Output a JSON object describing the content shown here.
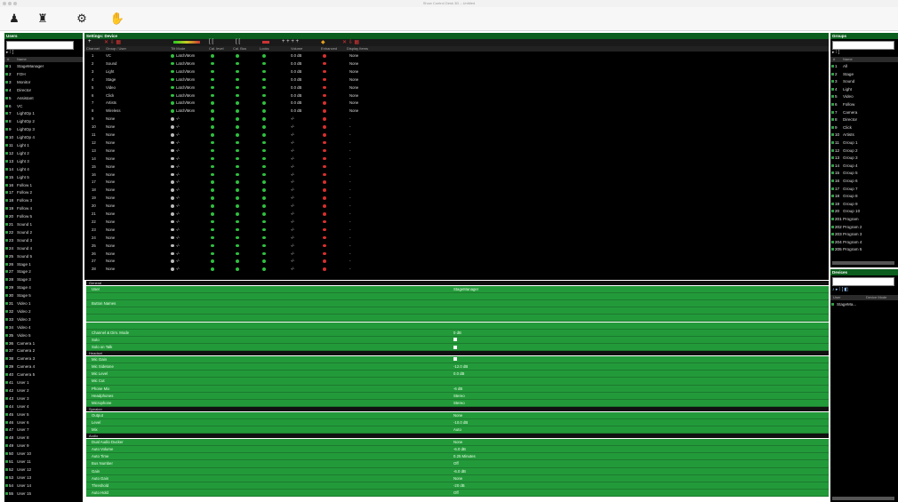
{
  "window": {
    "title": "Show Control Desk 3D – Untitled"
  },
  "toolbar": {
    "buttons": [
      {
        "icon": "person-icon",
        "glyph": "♟"
      },
      {
        "icon": "mixer-icon",
        "glyph": "♜"
      },
      {
        "icon": "gears-icon",
        "glyph": "⚙"
      },
      {
        "icon": "hands-icon",
        "glyph": "✋"
      }
    ]
  },
  "users": {
    "title": "Users",
    "col_number": "#",
    "col_name": "Name",
    "items": [
      {
        "n": "1",
        "name": "StageManager"
      },
      {
        "n": "2",
        "name": "FOH"
      },
      {
        "n": "3",
        "name": "Monitor"
      },
      {
        "n": "4",
        "name": "Director"
      },
      {
        "n": "5",
        "name": "Assistant"
      },
      {
        "n": "6",
        "name": "VC"
      },
      {
        "n": "7",
        "name": "LightOp 1"
      },
      {
        "n": "8",
        "name": "LightOp 2"
      },
      {
        "n": "9",
        "name": "LightOp 3"
      },
      {
        "n": "10",
        "name": "LightOp 4"
      },
      {
        "n": "11",
        "name": "Light 1"
      },
      {
        "n": "12",
        "name": "Light 2"
      },
      {
        "n": "13",
        "name": "Light 3"
      },
      {
        "n": "14",
        "name": "Light 4"
      },
      {
        "n": "15",
        "name": "Light 5"
      },
      {
        "n": "16",
        "name": "Follow 1"
      },
      {
        "n": "17",
        "name": "Follow 2"
      },
      {
        "n": "18",
        "name": "Follow 3"
      },
      {
        "n": "19",
        "name": "Follow 4"
      },
      {
        "n": "20",
        "name": "Follow 5"
      },
      {
        "n": "21",
        "name": "Sound 1"
      },
      {
        "n": "22",
        "name": "Sound 2"
      },
      {
        "n": "23",
        "name": "Sound 3"
      },
      {
        "n": "24",
        "name": "Sound 4"
      },
      {
        "n": "25",
        "name": "Sound 5"
      },
      {
        "n": "26",
        "name": "Stage 1"
      },
      {
        "n": "27",
        "name": "Stage 2"
      },
      {
        "n": "28",
        "name": "Stage 3"
      },
      {
        "n": "29",
        "name": "Stage 4"
      },
      {
        "n": "30",
        "name": "Stage 5"
      },
      {
        "n": "31",
        "name": "Video 1"
      },
      {
        "n": "32",
        "name": "Video 2"
      },
      {
        "n": "33",
        "name": "Video 3"
      },
      {
        "n": "34",
        "name": "Video 4"
      },
      {
        "n": "35",
        "name": "Video 5"
      },
      {
        "n": "36",
        "name": "Camera 1"
      },
      {
        "n": "37",
        "name": "Camera 2"
      },
      {
        "n": "38",
        "name": "Camera 3"
      },
      {
        "n": "39",
        "name": "Camera 4"
      },
      {
        "n": "40",
        "name": "Camera 5"
      },
      {
        "n": "41",
        "name": "User 1"
      },
      {
        "n": "42",
        "name": "User 2"
      },
      {
        "n": "43",
        "name": "User 3"
      },
      {
        "n": "44",
        "name": "User 4"
      },
      {
        "n": "45",
        "name": "User 5"
      },
      {
        "n": "46",
        "name": "User 6"
      },
      {
        "n": "47",
        "name": "User 7"
      },
      {
        "n": "48",
        "name": "User 8"
      },
      {
        "n": "49",
        "name": "User 9"
      },
      {
        "n": "50",
        "name": "User 10"
      },
      {
        "n": "51",
        "name": "User 11"
      },
      {
        "n": "52",
        "name": "User 12"
      },
      {
        "n": "53",
        "name": "User 13"
      },
      {
        "n": "54",
        "name": "User 14"
      },
      {
        "n": "55",
        "name": "User 15"
      }
    ]
  },
  "patch": {
    "title": "Settings: Device",
    "columns": [
      "Channel",
      "Group / User",
      "Tilt Mode",
      "Cal. level",
      "Cal. Bus",
      "Locks",
      "Volume",
      "Enhanced",
      "Display Items"
    ],
    "rows": [
      {
        "ch": "1",
        "name": "VC",
        "mode": "Latch/Mom",
        "vol": "0.0 dB",
        "disp": "None",
        "active": true
      },
      {
        "ch": "2",
        "name": "Sound",
        "mode": "Latch/Mom",
        "vol": "0.0 dB",
        "disp": "None",
        "active": true
      },
      {
        "ch": "3",
        "name": "Light",
        "mode": "Latch/Mom",
        "vol": "0.0 dB",
        "disp": "None",
        "active": true
      },
      {
        "ch": "4",
        "name": "Stage",
        "mode": "Latch/Mom",
        "vol": "0.0 dB",
        "disp": "None",
        "active": true
      },
      {
        "ch": "5",
        "name": "Video",
        "mode": "Latch/Mom",
        "vol": "0.0 dB",
        "disp": "None",
        "active": true
      },
      {
        "ch": "6",
        "name": "Click",
        "mode": "Latch/Mom",
        "vol": "0.0 dB",
        "disp": "None",
        "active": true
      },
      {
        "ch": "7",
        "name": "Artists",
        "mode": "Latch/Mom",
        "vol": "0.0 dB",
        "disp": "None",
        "active": true
      },
      {
        "ch": "8",
        "name": "Wireless",
        "mode": "Latch/Mom",
        "vol": "0.0 dB",
        "disp": "None",
        "active": true
      },
      {
        "ch": "9",
        "name": "None",
        "mode": "-/-",
        "vol": "-/-",
        "disp": "-",
        "active": false
      },
      {
        "ch": "10",
        "name": "None",
        "mode": "-/-",
        "vol": "-/-",
        "disp": "-",
        "active": false
      },
      {
        "ch": "11",
        "name": "None",
        "mode": "-/-",
        "vol": "-/-",
        "disp": "-",
        "active": false
      },
      {
        "ch": "12",
        "name": "None",
        "mode": "-/-",
        "vol": "-/-",
        "disp": "-",
        "active": false
      },
      {
        "ch": "13",
        "name": "None",
        "mode": "-/-",
        "vol": "-/-",
        "disp": "-",
        "active": false
      },
      {
        "ch": "14",
        "name": "None",
        "mode": "-/-",
        "vol": "-/-",
        "disp": "-",
        "active": false
      },
      {
        "ch": "15",
        "name": "None",
        "mode": "-/-",
        "vol": "-/-",
        "disp": "-",
        "active": false
      },
      {
        "ch": "16",
        "name": "None",
        "mode": "-/-",
        "vol": "-/-",
        "disp": "-",
        "active": false
      },
      {
        "ch": "17",
        "name": "None",
        "mode": "-/-",
        "vol": "-/-",
        "disp": "-",
        "active": false
      },
      {
        "ch": "18",
        "name": "None",
        "mode": "-/-",
        "vol": "-/-",
        "disp": "-",
        "active": false
      },
      {
        "ch": "19",
        "name": "None",
        "mode": "-/-",
        "vol": "-/-",
        "disp": "-",
        "active": false
      },
      {
        "ch": "20",
        "name": "None",
        "mode": "-/-",
        "vol": "-/-",
        "disp": "-",
        "active": false
      },
      {
        "ch": "21",
        "name": "None",
        "mode": "-/-",
        "vol": "-/-",
        "disp": "-",
        "active": false
      },
      {
        "ch": "22",
        "name": "None",
        "mode": "-/-",
        "vol": "-/-",
        "disp": "-",
        "active": false
      },
      {
        "ch": "23",
        "name": "None",
        "mode": "-/-",
        "vol": "-/-",
        "disp": "-",
        "active": false
      },
      {
        "ch": "24",
        "name": "None",
        "mode": "-/-",
        "vol": "-/-",
        "disp": "-",
        "active": false
      },
      {
        "ch": "25",
        "name": "None",
        "mode": "-/-",
        "vol": "-/-",
        "disp": "-",
        "active": false
      },
      {
        "ch": "26",
        "name": "None",
        "mode": "-/-",
        "vol": "-/-",
        "disp": "-",
        "active": false
      },
      {
        "ch": "27",
        "name": "None",
        "mode": "-/-",
        "vol": "-/-",
        "disp": "-",
        "active": false
      },
      {
        "ch": "28",
        "name": "None",
        "mode": "-/-",
        "vol": "-/-",
        "disp": "-",
        "active": false
      }
    ]
  },
  "settings": {
    "sections": [
      {
        "title": "General",
        "rows": [
          {
            "k": "User",
            "v": "StageManager"
          },
          {
            "k": "",
            "v": ""
          },
          {
            "k": "Button Names",
            "v": ""
          },
          {
            "k": "",
            "v": ""
          },
          {
            "k": "",
            "v": ""
          },
          {
            "k": "",
            "v": ""
          },
          {
            "k": "Channel & Dim. Mode",
            "v": "0 dB"
          },
          {
            "k": "Solo",
            "v": "",
            "check": true
          },
          {
            "k": "Solo on Talk",
            "v": "",
            "check": true
          }
        ]
      },
      {
        "title": "Headset",
        "rows": [
          {
            "k": "Mic Gain",
            "v": "",
            "check": true
          },
          {
            "k": "Mic Sidetone",
            "v": "-12.0 dB"
          },
          {
            "k": "Mic Level",
            "v": "0.0 dB"
          },
          {
            "k": "Mic Cut",
            "v": ""
          },
          {
            "k": "Phone Mix",
            "v": "-6 dB"
          },
          {
            "k": "Headphones",
            "v": "Stereo"
          },
          {
            "k": "Microphone",
            "v": "Stereo"
          }
        ]
      },
      {
        "title": "Speaker",
        "rows": [
          {
            "k": "Output",
            "v": "None"
          },
          {
            "k": "Level",
            "v": "-10.0 dB"
          },
          {
            "k": "Mix",
            "v": "Auto"
          }
        ]
      },
      {
        "title": "Audio",
        "rows": [
          {
            "k": "Dual Audio Ducker",
            "v": "None"
          },
          {
            "k": "Auto Volume",
            "v": "-6.0 dB"
          },
          {
            "k": "Auto Time",
            "v": "0.25 Minutes"
          },
          {
            "k": "Bus Number",
            "v": "Off"
          },
          {
            "k": "Gain",
            "v": "-6.0 dB"
          },
          {
            "k": "Auto Gain",
            "v": "None"
          },
          {
            "k": "Threshold",
            "v": "-20 dB"
          },
          {
            "k": "Auto Hold",
            "v": "Off"
          }
        ]
      }
    ]
  },
  "groups": {
    "title": "Groups",
    "col_number": "#",
    "col_name": "Name",
    "items": [
      {
        "n": "1",
        "name": "All"
      },
      {
        "n": "2",
        "name": "Stage"
      },
      {
        "n": "3",
        "name": "Sound"
      },
      {
        "n": "4",
        "name": "Light"
      },
      {
        "n": "5",
        "name": "Video"
      },
      {
        "n": "6",
        "name": "Follow"
      },
      {
        "n": "7",
        "name": "Camera"
      },
      {
        "n": "8",
        "name": "Director"
      },
      {
        "n": "9",
        "name": "Click"
      },
      {
        "n": "10",
        "name": "Artists"
      },
      {
        "n": "11",
        "name": "Group 1"
      },
      {
        "n": "12",
        "name": "Group 2"
      },
      {
        "n": "13",
        "name": "Group 3"
      },
      {
        "n": "14",
        "name": "Group 4"
      },
      {
        "n": "15",
        "name": "Group 5"
      },
      {
        "n": "16",
        "name": "Group 6"
      },
      {
        "n": "17",
        "name": "Group 7"
      },
      {
        "n": "18",
        "name": "Group 8"
      },
      {
        "n": "19",
        "name": "Group 9"
      },
      {
        "n": "20",
        "name": "Group 10"
      },
      {
        "n": "201",
        "name": "Program"
      },
      {
        "n": "202",
        "name": "Program 2"
      },
      {
        "n": "203",
        "name": "Program 3"
      },
      {
        "n": "204",
        "name": "Program 4"
      },
      {
        "n": "205",
        "name": "Program 5"
      }
    ]
  },
  "devices": {
    "title": "Devices",
    "col_a": "User",
    "col_b": "Device Mode",
    "items": [
      {
        "name": "StageMa..."
      }
    ]
  }
}
